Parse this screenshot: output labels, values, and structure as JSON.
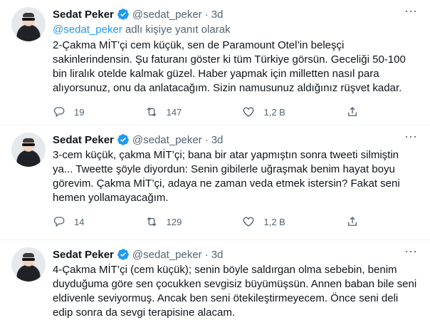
{
  "tweets": [
    {
      "name": "Sedat Peker",
      "handle": "@sedat_peker",
      "time": "3d",
      "reply_mention": "@sedat_peker",
      "reply_suffix": " adlı kişiye yanıt olarak",
      "text": "2-Çakma MİT’çi cem küçük, sen de Paramount Otel’in beleşçi sakinlerindensin.  Şu faturanı göster ki tüm Türkiye görsün. Geceliği 50-100 bin liralık otelde kalmak güzel. Haber yapmak için milletten nasıl para alıyorsunuz, onu da anlatacağım. Sizin namusunuz aldığınız rüşvet kadar.",
      "replies": "19",
      "retweets": "147",
      "likes": "1,2 B"
    },
    {
      "name": "Sedat Peker",
      "handle": "@sedat_peker",
      "time": "3d",
      "text": "3-cem küçük, çakma MİT’çi; bana bir atar yapmıştın sonra tweeti silmiştin ya... Tweette şöyle diyordun: Senin gibilerle uğraşmak benim hayat boyu görevim. Çakma MİT’çi, adaya ne zaman veda etmek istersin? Fakat seni hemen yollamayacağım.",
      "replies": "14",
      "retweets": "129",
      "likes": "1,2 B"
    },
    {
      "name": "Sedat Peker",
      "handle": "@sedat_peker",
      "time": "3d",
      "text": "4-Çakma MİT’çi (cem küçük); senin böyle saldırgan olma sebebin, benim duyduğuma göre sen çocukken sevgisiz büyümüşsün. Annen baban bile seni eldivenle seviyormuş. Ancak ben seni ötekileştirmeyecem. Önce seni deli edip sonra da sevgi terapisine alacam."
    }
  ],
  "separator": "·",
  "colors": {
    "accent": "#1d9bf0",
    "muted": "#536471",
    "text": "#0f1419"
  },
  "icons": [
    "verified-badge-icon",
    "more-icon",
    "reply-icon",
    "retweet-icon",
    "like-icon",
    "share-icon"
  ]
}
